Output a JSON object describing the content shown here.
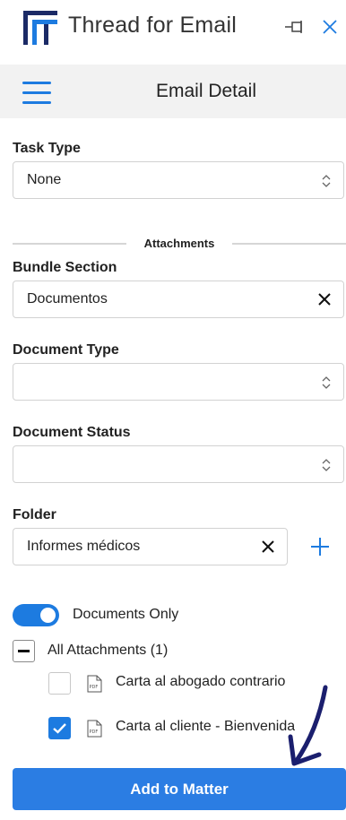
{
  "titlebar": {
    "app_title": "Thread for Email"
  },
  "header": {
    "title": "Email Detail"
  },
  "task_type": {
    "label": "Task Type",
    "value": "None"
  },
  "attachments_divider": "Attachments",
  "bundle_section": {
    "label": "Bundle Section",
    "value": "Documentos"
  },
  "document_type": {
    "label": "Document Type",
    "value": ""
  },
  "document_status": {
    "label": "Document Status",
    "value": ""
  },
  "folder": {
    "label": "Folder",
    "value": "Informes médicos"
  },
  "documents_only": {
    "label": "Documents Only",
    "on": true
  },
  "attachments": {
    "all_label": "All Attachments (1)",
    "items": [
      {
        "name": "Carta al abogado contrario",
        "checked": false
      },
      {
        "name": "Carta al cliente - Bienvenida",
        "checked": true
      }
    ]
  },
  "add_button": "Add to Matter",
  "colors": {
    "accent": "#1d7be0",
    "button": "#2b7de3",
    "arrow": "#1b1f6e"
  }
}
